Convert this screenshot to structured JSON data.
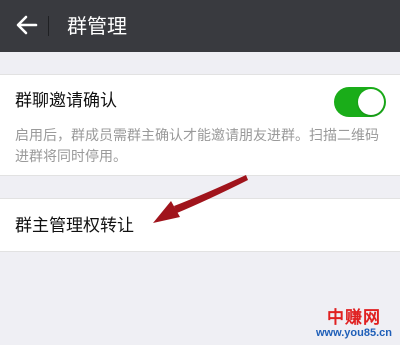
{
  "header": {
    "back_icon": "arrow-left-icon",
    "title": "群管理"
  },
  "settings": {
    "invite_confirm": {
      "label": "群聊邀请确认",
      "enabled": true,
      "accent_color": "#1aad19",
      "description": "启用后，群成员需群主确认才能邀请朋友进群。扫描二维码进群将同时停用。"
    },
    "transfer": {
      "label": "群主管理权转让"
    }
  },
  "annotation": {
    "arrow_color": "#a0141c"
  },
  "watermark": {
    "name": "中赚网",
    "url": "www.you85.cn"
  }
}
